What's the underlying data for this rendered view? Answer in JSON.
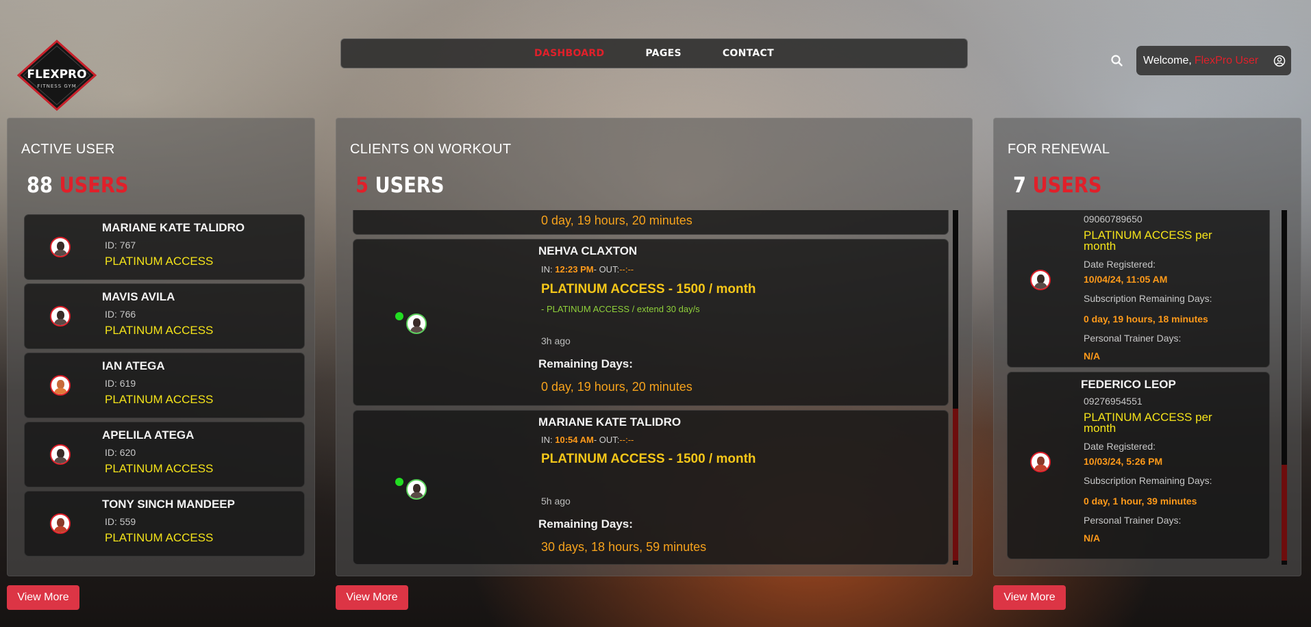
{
  "brand": {
    "logo_main": "FLEXPRO",
    "logo_sub": "FITNESS GYM"
  },
  "nav": {
    "items": [
      "DASHBOARD",
      "PAGES",
      "CONTACT"
    ],
    "active": "DASHBOARD"
  },
  "header": {
    "welcome_prefix": "Welcome,",
    "welcome_name": "FlexPro User"
  },
  "active_users": {
    "title": "ACTIVE USER",
    "count": "88",
    "count_label": "USERS",
    "view_more": "View More",
    "users": [
      {
        "name": "MARIANE KATE TALIDRO",
        "id": "ID: 767",
        "plan": "PLATINUM ACCESS"
      },
      {
        "name": "MAVIS AVILA",
        "id": "ID: 766",
        "plan": "PLATINUM ACCESS"
      },
      {
        "name": "IAN ATEGA",
        "id": "ID: 619",
        "plan": "PLATINUM ACCESS"
      },
      {
        "name": "APELILA ATEGA",
        "id": "ID: 620",
        "plan": "PLATINUM ACCESS"
      },
      {
        "name": "TONY SINCH MANDEEP",
        "id": "ID: 559",
        "plan": "PLATINUM ACCESS"
      }
    ]
  },
  "workout": {
    "title": "CLIENTS ON WORKOUT",
    "count": "5",
    "count_label": "USERS",
    "view_more": "View More",
    "partial_top_remaining": "0 day, 19 hours, 20 minutes",
    "clients": [
      {
        "name": "NEHVA CLAXTON",
        "in_label": "IN:",
        "in_time": "12:23 PM",
        "out_label": "- OUT:",
        "out_time": "--:--",
        "plan": "PLATINUM ACCESS - 1500 / month",
        "extend": "- PLATINUM ACCESS / extend 30 day/s",
        "ago": "3h ago",
        "remaining_label": "Remaining Days:",
        "remaining": "0 day, 19 hours, 20 minutes"
      },
      {
        "name": "MARIANE KATE TALIDRO",
        "in_label": "IN:",
        "in_time": "10:54 AM",
        "out_label": "- OUT:",
        "out_time": "--:--",
        "plan": "PLATINUM ACCESS - 1500 / month",
        "extend": "",
        "ago": "5h ago",
        "remaining_label": "Remaining Days:",
        "remaining": "30 days, 18 hours, 59 minutes"
      }
    ]
  },
  "renewal": {
    "title": "FOR RENEWAL",
    "count": "7",
    "count_label": "USERS",
    "view_more": "View More",
    "clients": [
      {
        "name": "",
        "phone": "09060789650",
        "plan": "PLATINUM ACCESS per month",
        "registered_label": "Date Registered:",
        "registered": "10/04/24, 11:05 AM",
        "sub_label": "Subscription Remaining Days:",
        "sub_remaining": "0 day, 19 hours, 18 minutes",
        "trainer_label": "Personal Trainer Days:",
        "trainer": "N/A"
      },
      {
        "name": "FEDERICO LEOP",
        "phone": "09276954551",
        "plan": "PLATINUM ACCESS per month",
        "registered_label": "Date Registered:",
        "registered": "10/03/24, 5:26 PM",
        "sub_label": "Subscription Remaining Days:",
        "sub_remaining": "0 day, 1 hour, 39 minutes",
        "trainer_label": "Personal Trainer Days:",
        "trainer": "N/A"
      }
    ]
  },
  "colors": {
    "accent_red": "#e0202a",
    "plan_yellow": "#f4e31a",
    "time_orange": "#ff9a1a",
    "online_green": "#22dd22"
  }
}
